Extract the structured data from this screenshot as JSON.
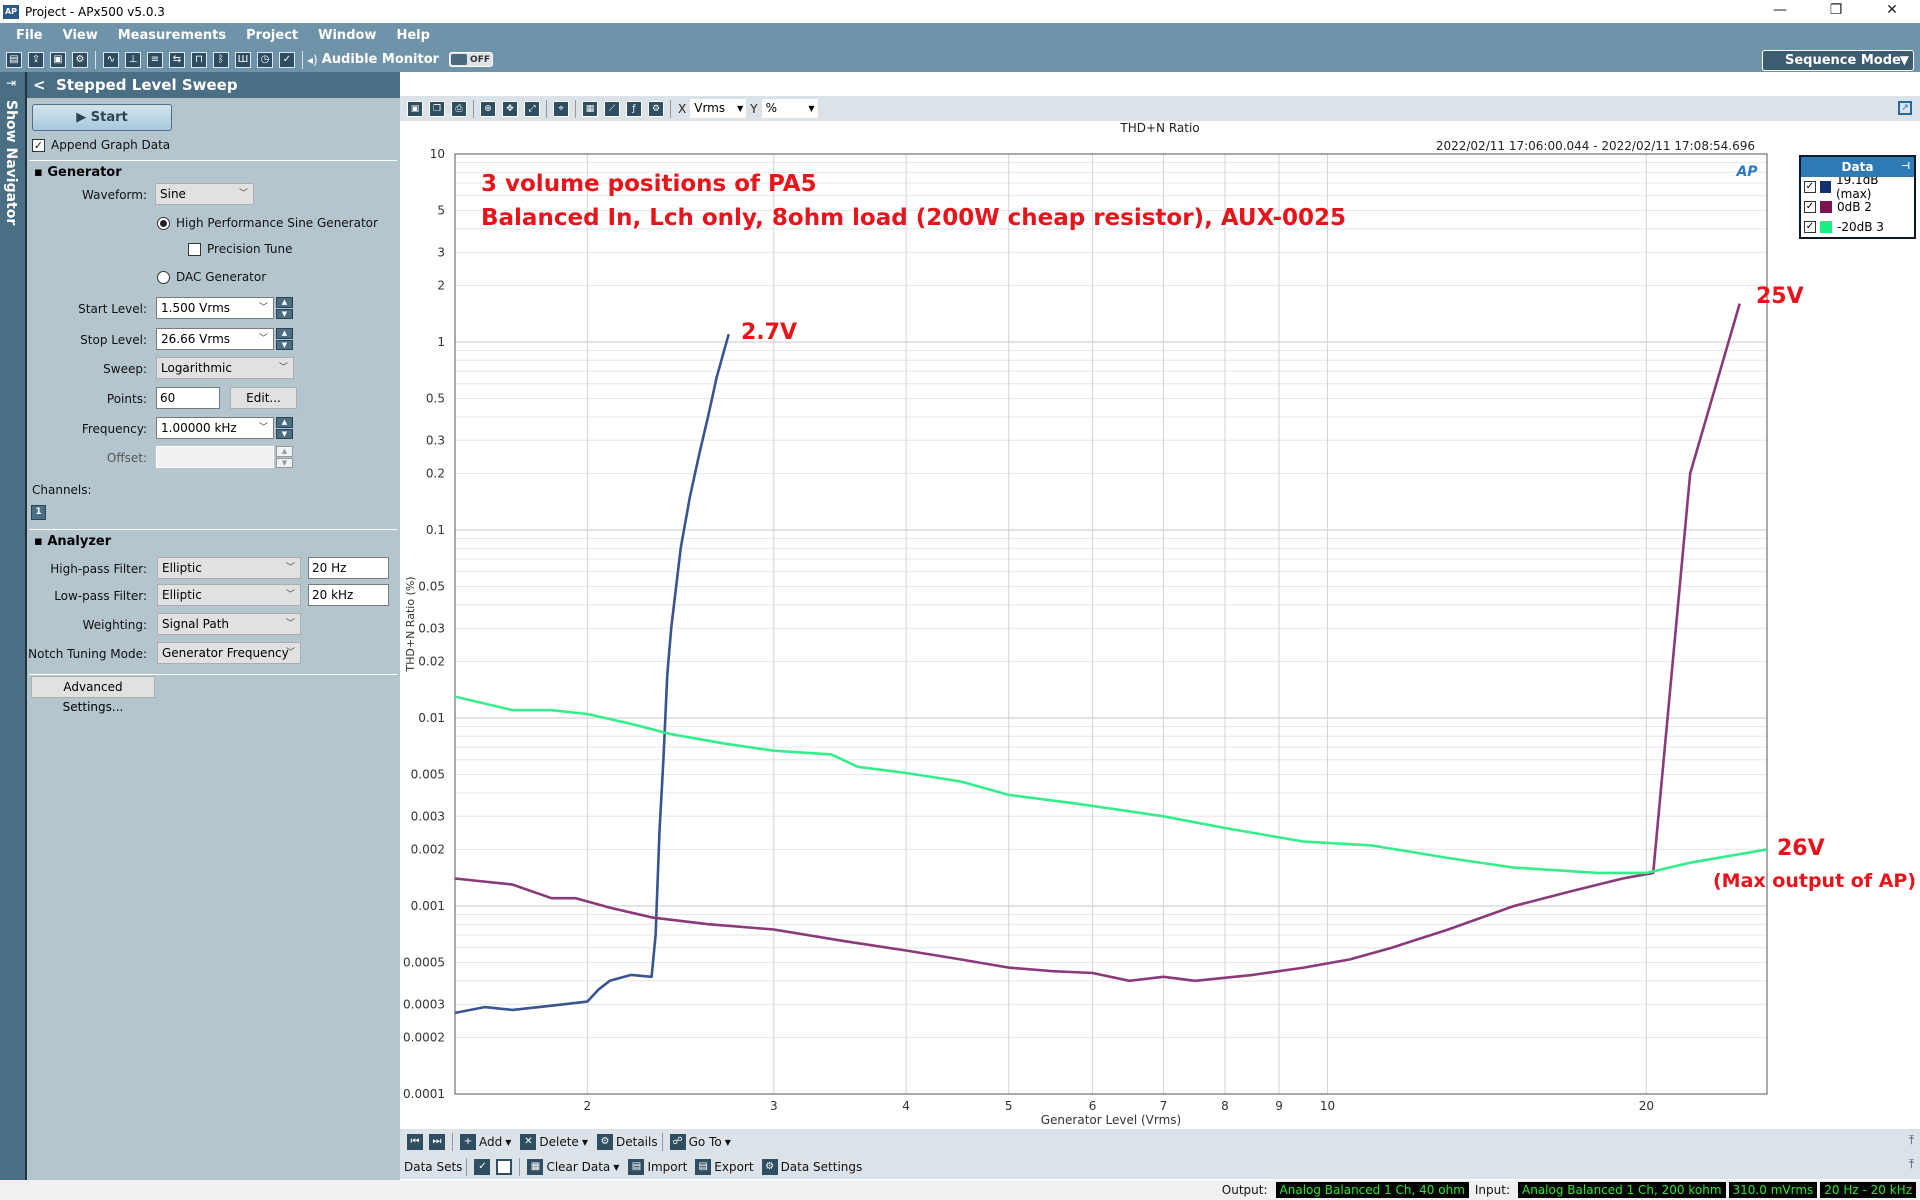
{
  "window": {
    "title": "Project - APx500 v5.0.3",
    "minimize": "—",
    "restore": "❐",
    "close": "✕"
  },
  "menu": [
    "File",
    "View",
    "Measurements",
    "Project",
    "Window",
    "Help"
  ],
  "toolbar": {
    "audible_monitor_label": "Audible Monitor",
    "toggle_state": "OFF",
    "sequence_mode": "Sequence Mode"
  },
  "navigator": {
    "label": "Show Navigator"
  },
  "panel": {
    "title": "Stepped Level Sweep",
    "start_label": "Start",
    "append_graph_data": {
      "label": "Append Graph Data",
      "checked": true
    },
    "generator": {
      "section": "Generator",
      "waveform_label": "Waveform:",
      "waveform": "Sine",
      "hp_sine": "High Performance Sine Generator",
      "precision_tune": "Precision Tune",
      "dac_generator": "DAC Generator",
      "start_level_label": "Start Level:",
      "start_level": "1.500 Vrms",
      "stop_level_label": "Stop Level:",
      "stop_level": "26.66 Vrms",
      "sweep_label": "Sweep:",
      "sweep": "Logarithmic",
      "points_label": "Points:",
      "points": "60",
      "edit_label": "Edit...",
      "frequency_label": "Frequency:",
      "frequency": "1.00000 kHz",
      "offset_label": "Offset:",
      "offset": ""
    },
    "channels_label": "Channels:",
    "channel_badge": "1",
    "analyzer": {
      "section": "Analyzer",
      "hpf_label": "High-pass Filter:",
      "hpf": "Elliptic",
      "hpf_value": "20 Hz",
      "lpf_label": "Low-pass Filter:",
      "lpf": "Elliptic",
      "lpf_value": "20 kHz",
      "weighting_label": "Weighting:",
      "weighting": "Signal Path",
      "notch_label": "Notch Tuning Mode:",
      "notch": "Generator Frequency"
    },
    "advanced_label": "Advanced Settings..."
  },
  "graph_toolbar": {
    "x_label": "X",
    "x_unit": "Vrms",
    "y_label": "Y",
    "y_unit": "%"
  },
  "graph": {
    "time_range": "2022/02/11 17:06:00.044 - 2022/02/11 17:08:54.696",
    "logo": "AP"
  },
  "legend": {
    "title": "Data",
    "items": [
      {
        "label": "19.1dB (max)",
        "color": "#14306e"
      },
      {
        "label": "0dB 2",
        "color": "#7a1450"
      },
      {
        "label": "-20dB 3",
        "color": "#19f07f"
      }
    ]
  },
  "annotations": {
    "line1": "3 volume positions of PA5",
    "line2": "Balanced In, Lch only, 8ohm load (200W cheap resistor), AUX-0025",
    "label_27": "2.7V",
    "label_25": "25V",
    "label_26": "26V",
    "label_max": "(Max output of AP)"
  },
  "bottom_toolbar": {
    "add": "Add",
    "delete": "Delete",
    "details": "Details",
    "goto": "Go To",
    "data_sets": "Data Sets",
    "clear_data": "Clear Data",
    "import": "Import",
    "export": "Export",
    "data_settings": "Data Settings"
  },
  "status": {
    "output_label": "Output:",
    "output": "Analog Balanced 1 Ch, 40 ohm",
    "input_label": "Input:",
    "input": "Analog Balanced 1 Ch, 200 kohm",
    "level": "310.0 mVrms",
    "bandwidth": "20 Hz - 20 kHz"
  },
  "chart_data": {
    "type": "line",
    "title": "THD+N Ratio",
    "xlabel": "Generator Level (Vrms)",
    "ylabel": "THD+N Ratio (%)",
    "xscale": "log",
    "yscale": "log",
    "xlim": [
      1.5,
      26.0
    ],
    "ylim": [
      0.0001,
      10
    ],
    "x_ticks": [
      2,
      3,
      4,
      5,
      6,
      7,
      8,
      9,
      10,
      20
    ],
    "y_ticks": [
      10,
      5,
      3,
      2,
      1,
      0.5,
      0.3,
      0.2,
      0.1,
      0.05,
      0.03,
      0.02,
      0.01,
      0.005,
      0.003,
      0.002,
      0.001,
      0.0005,
      0.0003,
      0.0002,
      0.0001
    ],
    "grid": true,
    "legend": "top-right",
    "series": [
      {
        "name": "19.1dB (max)",
        "color": "#3a5490",
        "x": [
          1.5,
          1.6,
          1.7,
          1.8,
          1.9,
          2.0,
          2.05,
          2.1,
          2.2,
          2.3,
          2.32,
          2.34,
          2.36,
          2.38,
          2.4,
          2.45,
          2.5,
          2.55,
          2.6,
          2.65,
          2.72
        ],
        "y": [
          0.00027,
          0.00029,
          0.00028,
          0.00029,
          0.0003,
          0.00031,
          0.00036,
          0.0004,
          0.00043,
          0.00042,
          0.0007,
          0.0025,
          0.006,
          0.017,
          0.03,
          0.08,
          0.15,
          0.25,
          0.4,
          0.65,
          1.1
        ]
      },
      {
        "name": "0dB 2",
        "color": "#8a3a78",
        "x": [
          1.5,
          1.7,
          1.85,
          1.95,
          2.1,
          2.3,
          2.6,
          3.0,
          3.5,
          4.0,
          4.5,
          5.0,
          5.5,
          6.0,
          6.5,
          7.0,
          7.5,
          8.5,
          9.5,
          10.5,
          11.5,
          13,
          15,
          17,
          19,
          20.3,
          22,
          24.5
        ],
        "y": [
          0.0014,
          0.0013,
          0.0011,
          0.0011,
          0.00098,
          0.00087,
          0.0008,
          0.00075,
          0.00065,
          0.00058,
          0.00052,
          0.00047,
          0.00045,
          0.00044,
          0.0004,
          0.00042,
          0.0004,
          0.00043,
          0.00047,
          0.00052,
          0.0006,
          0.00075,
          0.001,
          0.0012,
          0.0014,
          0.0015,
          0.2,
          1.6
        ]
      },
      {
        "name": "-20dB 3",
        "color": "#34ee8c",
        "x": [
          1.5,
          1.7,
          1.85,
          2.0,
          2.2,
          2.4,
          2.7,
          3.0,
          3.4,
          3.6,
          4.0,
          4.5,
          5.0,
          5.8,
          7.0,
          8.0,
          9.5,
          11,
          13,
          15,
          18,
          20,
          22,
          26
        ],
        "y": [
          0.013,
          0.011,
          0.011,
          0.0105,
          0.0093,
          0.0082,
          0.0073,
          0.0067,
          0.0064,
          0.0055,
          0.0051,
          0.0046,
          0.0039,
          0.0035,
          0.003,
          0.0026,
          0.0022,
          0.0021,
          0.0018,
          0.0016,
          0.0015,
          0.0015,
          0.0017,
          0.002
        ]
      }
    ]
  }
}
